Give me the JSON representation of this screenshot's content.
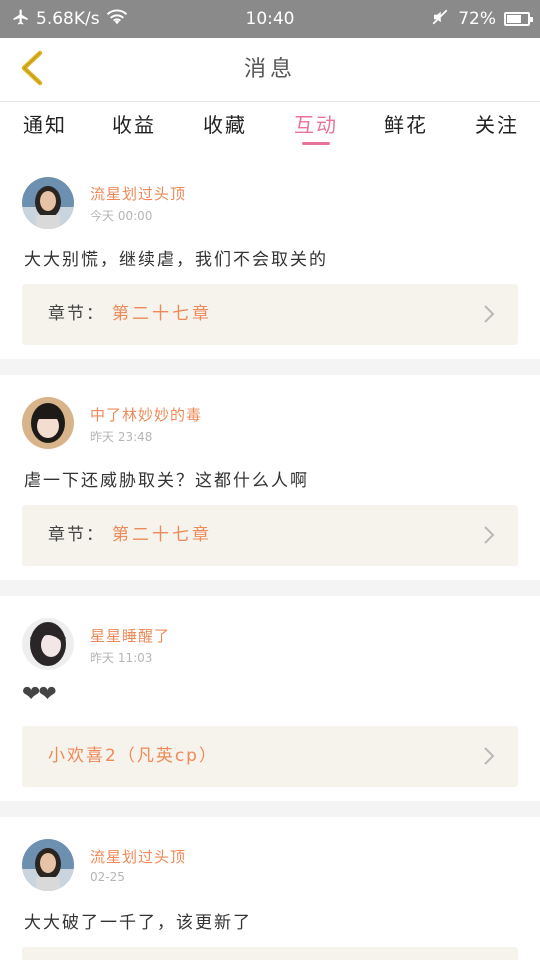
{
  "status_bar": {
    "speed": "5.68K/s",
    "time": "10:40",
    "battery": "72%",
    "battery_level": 0.72
  },
  "header": {
    "title": "消息",
    "back_icon": "chevron-left-icon"
  },
  "tabs": [
    {
      "label": "通知",
      "active": false
    },
    {
      "label": "收益",
      "active": false
    },
    {
      "label": "收藏",
      "active": false
    },
    {
      "label": "互动",
      "active": true
    },
    {
      "label": "鲜花",
      "active": false
    },
    {
      "label": "关注",
      "active": false
    }
  ],
  "messages": [
    {
      "username": "流星划过头顶",
      "time": "今天 00:00",
      "comment": "大大别慌，继续虐，我们不会取关的",
      "chapter_prefix": "章节：",
      "chapter": "第二十七章"
    },
    {
      "username": "中了林妙妙的毒",
      "time": "昨天 23:48",
      "comment": "虐一下还威胁取关？这都什么人啊",
      "chapter_prefix": "章节：",
      "chapter": "第二十七章"
    },
    {
      "username": "星星睡醒了",
      "time": "昨天 11:03",
      "comment": "❤❤",
      "chapter_prefix": "",
      "chapter": "小欢喜2（凡英cp）"
    },
    {
      "username": "流星划过头顶",
      "time": "02-25",
      "comment": "大大破了一千了，该更新了",
      "chapter_prefix": "",
      "chapter": ""
    }
  ],
  "colors": {
    "accent": "#e8739a",
    "username": "#ee8a5a",
    "status_bar": "#8a8a8a",
    "chapter_box": "#f5f3ec"
  }
}
